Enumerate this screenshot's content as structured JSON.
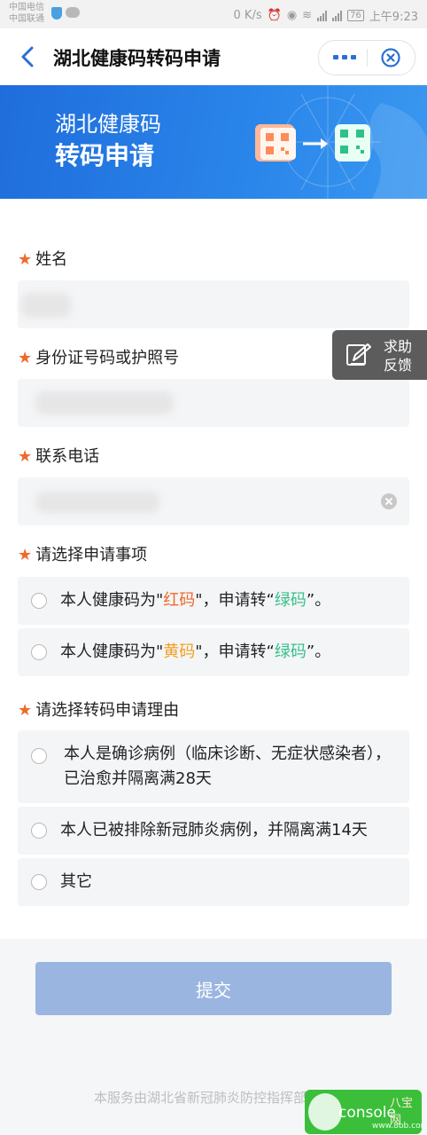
{
  "status_bar": {
    "carrier1": "中国电信",
    "carrier2": "中国联通",
    "net_speed": "0 K/s",
    "network1": "3G",
    "network2": "4G",
    "battery": "76",
    "time": "上午9:23"
  },
  "nav": {
    "title": "湖北健康码转码申请"
  },
  "banner": {
    "line1": "湖北健康码",
    "line2": "转码申请"
  },
  "form": {
    "name_label": "姓名",
    "id_label": "身份证号码或护照号",
    "phone_label": "联系电话",
    "item_label": "请选择申请事项",
    "item_options": [
      {
        "prefix": "本人健康码为\"",
        "from": "红码",
        "mid": "\"，申请转“",
        "to": "绿码",
        "suffix": "”。"
      },
      {
        "prefix": "本人健康码为\"",
        "from": "黄码",
        "mid": "\"，申请转“",
        "to": "绿码",
        "suffix": "”。"
      }
    ],
    "reason_label": "请选择转码申请理由",
    "reason_options": [
      "本人是确诊病例（临床诊断、无症状感染者），已治愈并隔离满28天",
      "本人已被排除新冠肺炎病例，并隔离满14天",
      "其它"
    ],
    "required_mark": "★"
  },
  "help": {
    "line1": "求助",
    "line2": "反馈"
  },
  "submit_label": "提交",
  "footer_text": "本服务由湖北省新冠肺炎防控指挥部提供",
  "watermark": {
    "text": "console",
    "brand": "八宝网",
    "site": "www.8bb.com"
  },
  "colors": {
    "accent": "#2b6fd6",
    "required": "#ee6a2c",
    "red_code": "#ee6a2c",
    "yellow_code": "#f0a020",
    "green_code": "#38c08a",
    "submit_disabled": "#9ab6e0"
  }
}
